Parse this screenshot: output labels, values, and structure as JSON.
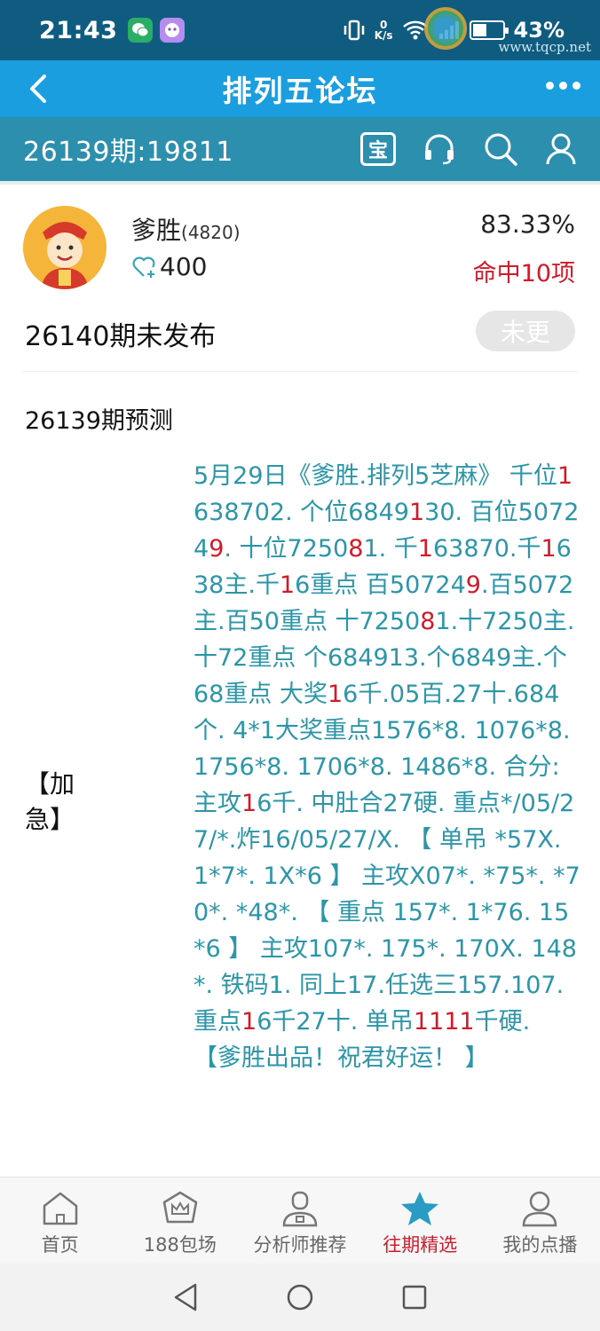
{
  "status_bar": {
    "time": "21:43",
    "net_speed_top": "0",
    "net_speed_unit": "K/s",
    "battery": "43%",
    "watermark": "www.tqcp.net"
  },
  "title_bar": {
    "title": "排列五论坛"
  },
  "sub_bar": {
    "issue_label": "26139期:19811",
    "bao_label": "宝"
  },
  "profile": {
    "name": "爹胜",
    "name_count": "(4820)",
    "fans": "400",
    "rate": "83.33%",
    "hits": "命中10项"
  },
  "next_issue": {
    "text": "26140期未发布",
    "button": "未更"
  },
  "prediction": {
    "title": "26139期预测",
    "tag": "【加急】",
    "content_html": "5月29日《爹胜.排列5芝麻》 千位<span class=\"r\">1</span>638702. 个位6849<span class=\"r\">1</span>30. 百位50724<span class=\"r\">9</span>. 十位7250<span class=\"r\">8</span>1. 千<span class=\"r\">1</span>63870.千<span class=\"r\">1</span>638主.千<span class=\"r\">1</span>6重点 百50724<span class=\"r\">9</span>.百5072主.百50重点 十7250<span class=\"r\">8</span>1.十7250主.十72重点 个684913.个6849主.个68重点 大奖<span class=\"r\">1</span>6千.05百.27十.684个. 4*1大奖重点1576*8. 1076*8. 1756*8. 1706*8. 1486*8. 合分:主攻<span class=\"r\">1</span>6千. 中肚合27硬. 重点*/05/27/*.炸16/05/27/X. 【 单吊 *57X. 1*7*. 1X*6 】 主攻X07*. *75*. *70*. *48*. 【 重点 157*. 1*76. 15*6 】 主攻107*. 175*. 170X. 148*. 铁码1. 同上17.任选三157.107. 重点<span class=\"r\">1</span>6千27十. 单吊<span class=\"r\">1111</span>千硬. 【爹胜出品！祝君好运！ 】"
  },
  "bottom_nav": [
    {
      "label": "首页",
      "icon": "home-icon"
    },
    {
      "label": "188包场",
      "icon": "crown-icon"
    },
    {
      "label": "分析师推荐",
      "icon": "analyst-icon"
    },
    {
      "label": "往期精选",
      "icon": "star-icon",
      "active": true
    },
    {
      "label": "我的点播",
      "icon": "user-icon"
    }
  ],
  "colors": {
    "status_bar": "#0f5c80",
    "title_bar": "#1a9ee0",
    "sub_bar": "#2c8fae",
    "content_text": "#2c96a8",
    "highlight_red": "#d11a2a"
  }
}
